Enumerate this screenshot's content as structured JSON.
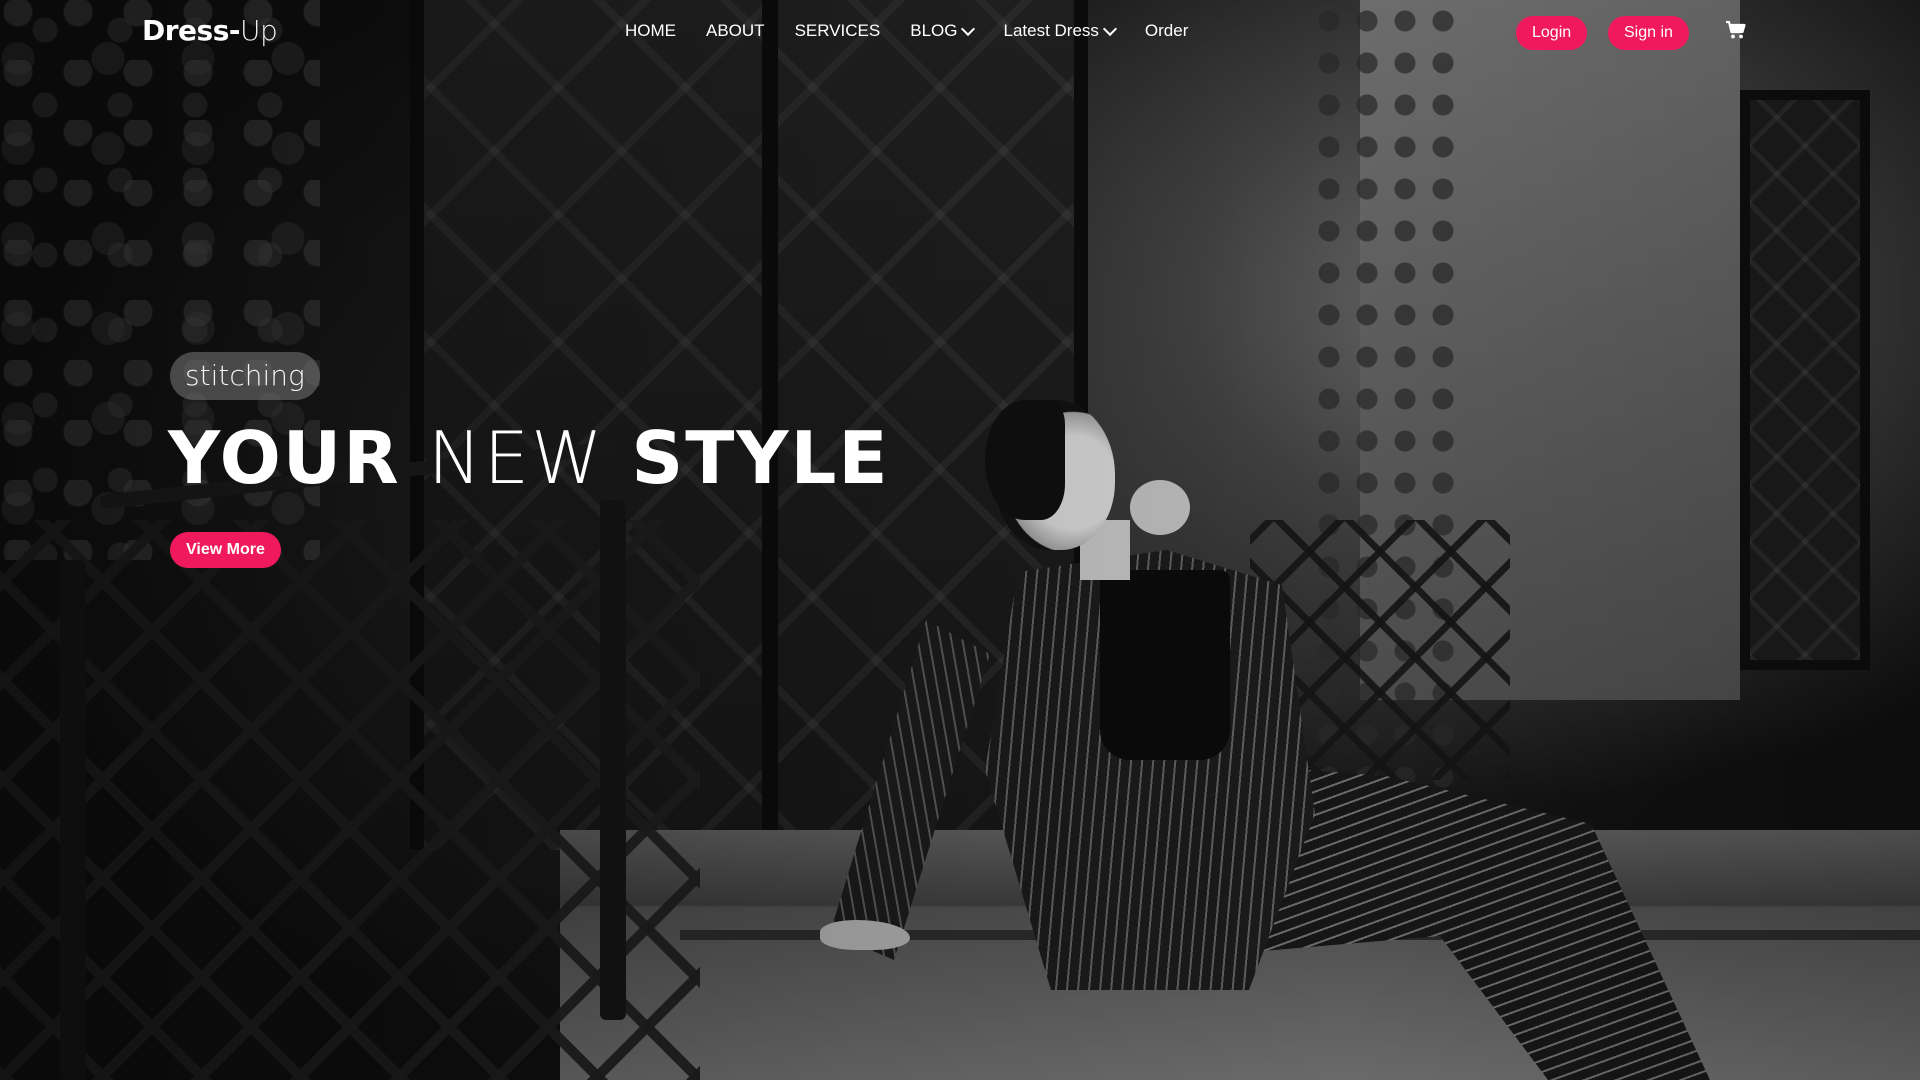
{
  "brand": {
    "part1": "Dress-",
    "part2": "Up"
  },
  "nav": {
    "items": [
      {
        "label": "HOME",
        "dropdown": false
      },
      {
        "label": "ABOUT",
        "dropdown": false
      },
      {
        "label": "SERVICES",
        "dropdown": false
      },
      {
        "label": "BLOG",
        "dropdown": true
      },
      {
        "label": "Latest Dress",
        "dropdown": true
      },
      {
        "label": "Order",
        "dropdown": false
      }
    ],
    "login_label": "Login",
    "signin_label": "Sign in",
    "cart_icon": "cart-icon"
  },
  "hero": {
    "tagline": "stitching",
    "headline": {
      "word1": "YOUR",
      "word2": "NEW",
      "word3": "STYLE"
    },
    "cta_label": "View More",
    "background": "black-and-white photo of a woman in a pinstripe suit seated on stone steps beside wrought-iron doors and railing"
  },
  "colors": {
    "accent": "#f0195d",
    "text": "#ffffff",
    "tagline_bg": "#787878"
  }
}
